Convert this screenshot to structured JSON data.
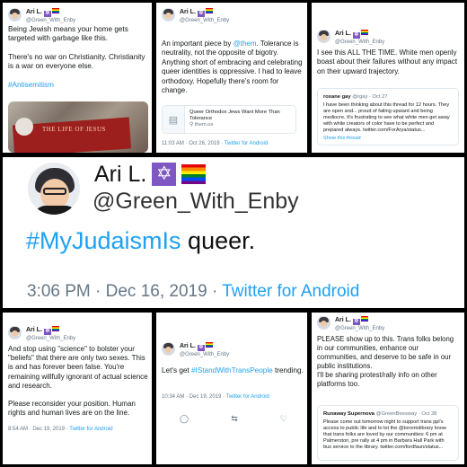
{
  "user": {
    "name": "Ari L.",
    "handle": "@Green_With_Enby"
  },
  "tweets": {
    "tl": {
      "paragraphs": [
        "Being Jewish means your home gets targeted with garbage like this.",
        "There's no war on Christianity. Christianity is a war on everyone else."
      ],
      "hashtag": "#Antisemitism",
      "image_text": "THE LIFE OF JESUS"
    },
    "tm": {
      "before_mention": "An important piece by ",
      "mention": "@them",
      "after_mention": ". Tolerance is neutrality, not the opposite of bigotry. Anything short of embracing and celebrating queer identities is oppressive. I had to leave orthodoxy. Hopefully there's room for change.",
      "card_title": "Queer Orthodox Jews Want More Than Tolerance",
      "card_domain": "them.us",
      "time": "11:03 AM · Oct 26, 2019 · ",
      "source": "Twitter for Android"
    },
    "tr": {
      "text": "I see this ALL THE TIME. White men openly boast about their failures without any impact on their upward trajectory.",
      "quote_name": "roxane gay",
      "quote_handle": "@rgay · Oct 27",
      "quote_text": "I have been thinking about this thread for 12 hours. They are open and... proud of failing upward and being mediocre. It's frustrating to see what white men get away with while creators of color have to be perfect and prepared always. twitter.com/ForArya/status...",
      "show_thread": "Show this thread"
    },
    "mid": {
      "hashtag": "#MyJudaismIs",
      "rest": " queer.",
      "time": "3:06 PM · Dec 16, 2019 · ",
      "source": "Twitter for Android"
    },
    "bl": {
      "para1": "And stop using \"science\" to bolster your \"beliefs\" that there are only two sexes. This is and has forever been false. You're remaining willfully ignorant of actual science and research.",
      "para2": "Please reconsider your position. Human rights and human lives are on the line.",
      "time": "8:54 AM · Dec 19, 2019 · ",
      "source": "Twitter for Android"
    },
    "bm": {
      "before": "Let's get ",
      "hashtag": "#IStandWithTransPeople",
      "after": " trending.",
      "time": "10:34 AM · Dec 19, 2019 · ",
      "source": "Twitter for Android"
    },
    "br": {
      "text": "PLEASE show up to this. Trans folks belong in our communities, enhance our communities, and deserve to be safe in our public institutions.",
      "text2": "I'll be sharing protest/rally info on other platforms too.",
      "quote_name": "Runaway Supernova",
      "quote_handle": "@GreenBeesway · Oct 28",
      "quote_text": "Please come out tomorrow night to support trans ppl's access to public life and to let the @torontolibrary know that trans folks are loved by our communities: 6 pm at Palmerston, pre rally at 4 pm in Barbara Hall Park with bus service to the library. twitter.com/fordfaun/status..."
    }
  }
}
